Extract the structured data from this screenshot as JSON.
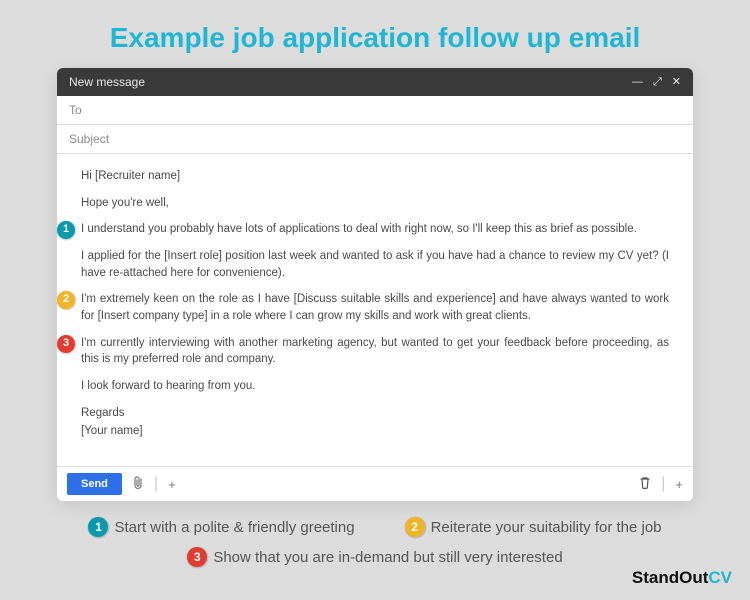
{
  "page_title": "Example job application follow up email",
  "window": {
    "title": "New message",
    "to_placeholder": "To",
    "subject_placeholder": "Subject"
  },
  "body": {
    "greeting": "Hi [Recruiter name]",
    "wellwish": "Hope you're well,",
    "para1": "I understand you probably have lots of applications to deal with right now, so I'll keep this as brief as possible.",
    "para2": "I applied for the [Insert role] position last week and wanted to ask if you have had a chance to review my CV yet? (I have re-attached here for convenience).",
    "para3": "I'm extremely keen on the role as I have [Discuss suitable skills and experience] and have always wanted to work for [Insert company type] in a role where I can grow my skills and work with great clients.",
    "para4": "I'm currently interviewing with another marketing agency, but wanted to get your feedback before proceeding, as this is my preferred role and company.",
    "closing1": "I look forward to hearing from you.",
    "signoff": "Regards",
    "name": "[Your name]"
  },
  "badges": {
    "n1": "1",
    "n2": "2",
    "n3": "3"
  },
  "toolbar": {
    "send": "Send"
  },
  "legend": {
    "l1": "Start with a polite & friendly greeting",
    "l2": "Reiterate your suitability for the job",
    "l3": "Show that you are in-demand but still very interested"
  },
  "brand": {
    "part1": "StandOut",
    "part2": "CV"
  }
}
